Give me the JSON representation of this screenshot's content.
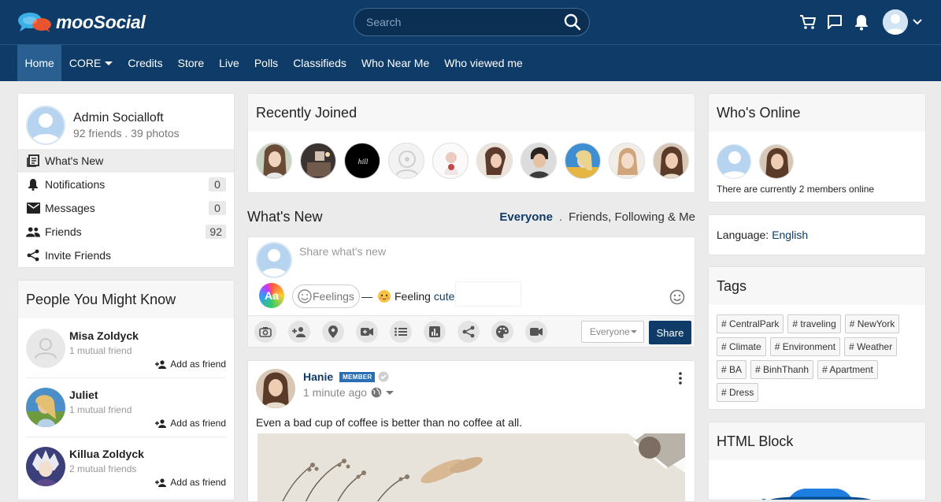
{
  "header": {
    "logo_text": "mooSocial",
    "search_placeholder": "Search"
  },
  "nav": {
    "items": [
      "Home",
      "CORE",
      "Credits",
      "Store",
      "Live",
      "Polls",
      "Classifieds",
      "Who Near Me",
      "Who viewed me"
    ]
  },
  "profile": {
    "name": "Admin Socialloft",
    "stats": "92 friends . 39 photos",
    "menu": [
      {
        "label": "What's New"
      },
      {
        "label": "Notifications",
        "count": "0"
      },
      {
        "label": "Messages",
        "count": "0"
      },
      {
        "label": "Friends",
        "count": "92"
      },
      {
        "label": "Invite Friends"
      }
    ]
  },
  "people": {
    "title": "People You Might Know",
    "add_label": "Add as friend",
    "items": [
      {
        "name": "Misa Zoldyck",
        "mutual": "1 mutual friend"
      },
      {
        "name": "Juliet",
        "mutual": "1 mutual friend"
      },
      {
        "name": "Killua Zoldyck",
        "mutual": "2 mutual friends"
      }
    ]
  },
  "recently_joined": {
    "title": "Recently Joined"
  },
  "whats_new": {
    "title": "What's New",
    "filter_active": "Everyone",
    "filter_sep": ".",
    "filter_other": "Friends, Following & Me"
  },
  "composer": {
    "placeholder": "Share what's new",
    "aa_label": "Aa",
    "feelings_label": "Feelings",
    "dash": "—",
    "feeling_prefix": "Feeling",
    "feeling_value": "cute",
    "privacy": "Everyone",
    "share_label": "Share"
  },
  "post": {
    "author": "Hanie",
    "badge": "MEMBER",
    "time": "1 minute ago",
    "text": "Even a bad cup of coffee is better than no coffee at all."
  },
  "online": {
    "title": "Who's Online",
    "note": "There are currently 2 members online"
  },
  "language": {
    "label": "Language:",
    "value": "English"
  },
  "tags": {
    "title": "Tags",
    "items": [
      "# CentralPark",
      "# traveling",
      "# NewYork",
      "# Climate",
      "# Environment",
      "# Weather",
      "# BA",
      "# BinhThanh",
      "# Apartment",
      "# Dress"
    ]
  },
  "html_block": {
    "title": "HTML Block"
  },
  "colors": {
    "brand": "#0e3b67",
    "nav_active": "#2a5f92",
    "background": "#ebebeb"
  }
}
